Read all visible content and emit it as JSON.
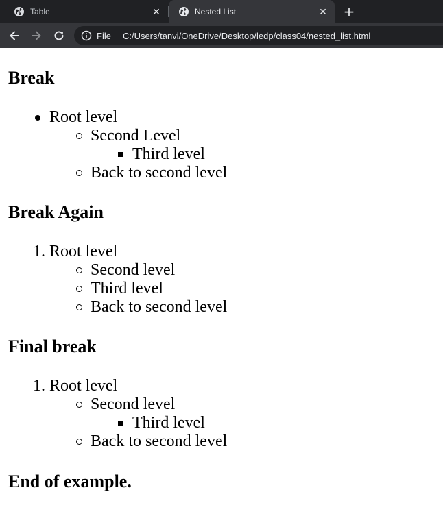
{
  "browser": {
    "tabs": [
      {
        "title": "Table",
        "active": false
      },
      {
        "title": "Nested List",
        "active": true
      }
    ],
    "new_tab_label": "+",
    "address": {
      "scheme_label": "File",
      "url": "C:/Users/tanvi/OneDrive/Desktop/ledp/class04/nested_list.html"
    }
  },
  "page": {
    "sections": [
      {
        "heading": "Break",
        "root": "Root level",
        "items": [
          "Second Level",
          "Third level",
          "Back to second level"
        ]
      },
      {
        "heading": "Break Again",
        "root_marker": "1.",
        "root": "Root level",
        "items": [
          "Second level",
          "Third level",
          "Back to second level"
        ]
      },
      {
        "heading": "Final break",
        "root_marker": "1.",
        "root": "Root level",
        "items": [
          "Second level",
          "Third level",
          "Back to second level"
        ]
      }
    ],
    "footer_heading": "End of example."
  }
}
